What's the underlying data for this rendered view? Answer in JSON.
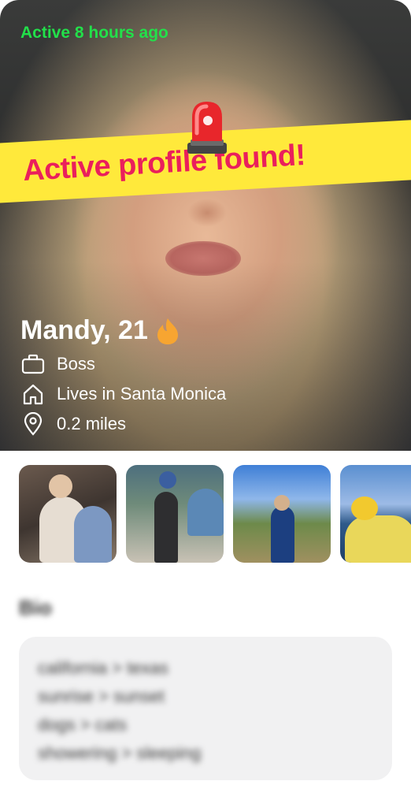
{
  "profile": {
    "active_status": "Active 8 hours ago",
    "banner_text": "Active profile found!",
    "name_age": "Mandy, 21",
    "job": "Boss",
    "location": "Lives in Santa Monica",
    "distance": "0.2 miles"
  },
  "photos": [
    {
      "alt": "photo-1"
    },
    {
      "alt": "photo-2"
    },
    {
      "alt": "photo-3"
    },
    {
      "alt": "photo-4"
    }
  ],
  "bio": {
    "title": "Bio",
    "lines": [
      "california > texas",
      "sunrise > sunset",
      "dogs > cats",
      "showering > sleeping"
    ]
  },
  "icons": {
    "siren": "police-siren-icon",
    "flame": "flame-icon",
    "job": "briefcase-icon",
    "home": "home-icon",
    "pin": "location-pin-icon"
  },
  "colors": {
    "active_green": "#22e04a",
    "banner_yellow": "#ffe93b",
    "banner_pink": "#ea1f5c"
  }
}
